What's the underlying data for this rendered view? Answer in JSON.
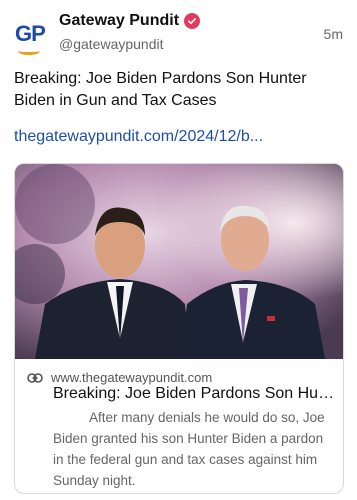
{
  "post": {
    "author": "Gateway Pundit",
    "handle": "@gatewaypundit",
    "timestamp": "5m",
    "avatar_text": "GP",
    "text": "Breaking: Joe Biden Pardons Son Hunter Biden in Gun and Tax Cases",
    "link_text": "thegatewaypundit.com/2024/12/b...",
    "colors": {
      "link": "#1d4fa8",
      "verified": "#e23b61",
      "avatar_text": "#1e4aa8",
      "avatar_swoosh": "#e8a21a"
    }
  },
  "card": {
    "domain": "www.thegatewaypundit.com",
    "title": "Breaking: Joe Biden Pardons Son Hunter Biden in Gun and Tax Cases",
    "description": "After many denials he would do so, Joe Biden granted his son Hunter Biden a pardon in the federal gun and tax cases against him Sunday night.",
    "link_icon": "link-icon"
  }
}
